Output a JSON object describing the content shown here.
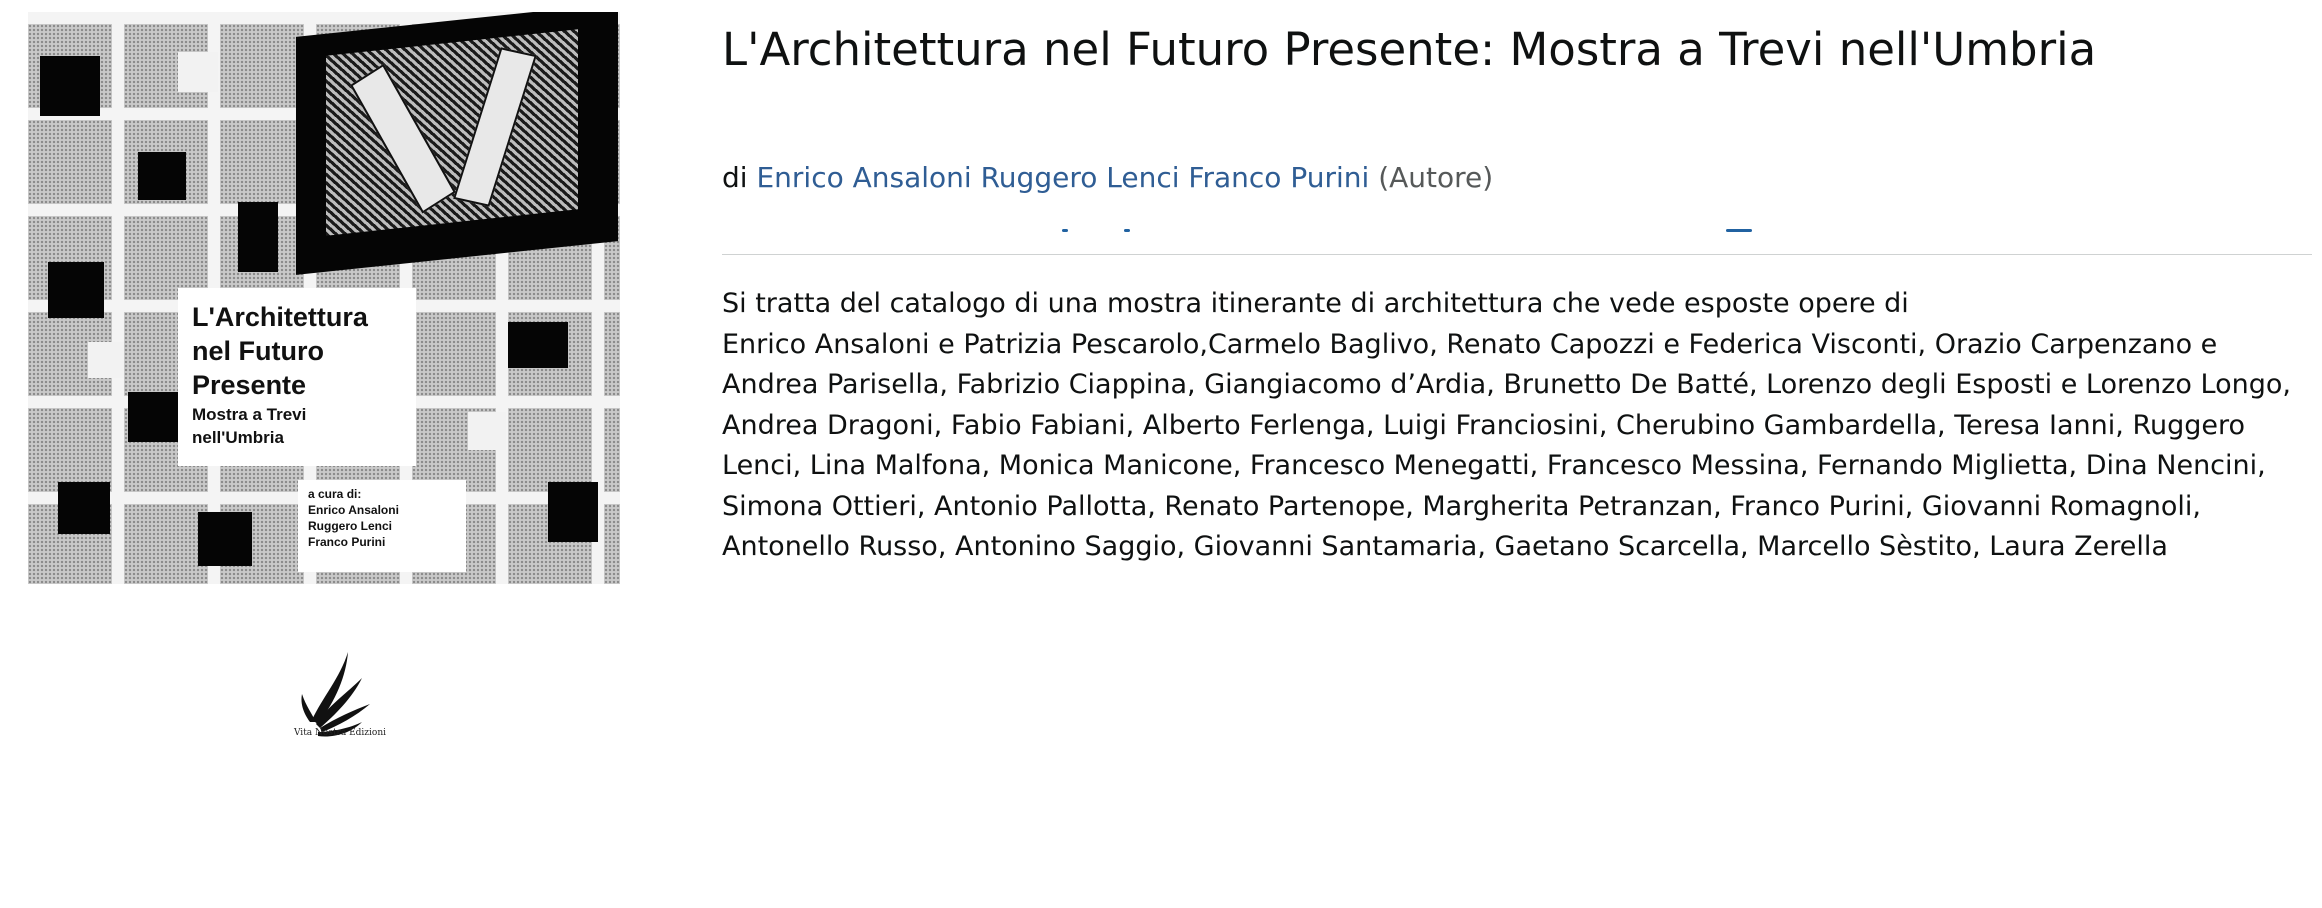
{
  "product": {
    "title": "L'Architettura nel Futuro Presente: Mostra a Trevi nell'Umbria",
    "byline_prefix": "di",
    "authors": "Enrico Ansaloni Ruggero Lenci Franco Purini",
    "role": "(Autore)",
    "description_line1": "Si tratta del catalogo di una mostra itinerante di architettura che vede esposte opere di",
    "description_line2": "Enrico Ansaloni e Patrizia Pescarolo,Carmelo Baglivo, Renato Capozzi e Federica Visconti, Orazio Carpenzano e Andrea Parisella, Fabrizio Ciappina, Giangiacomo d’Ardia, Brunetto De Batté, Lorenzo degli Esposti e Lorenzo Longo, Andrea Dragoni, Fabio Fabiani, Alberto Ferlenga, Luigi Franciosini, Cherubino Gambardella, Teresa Ianni, Ruggero Lenci, Lina Malfona, Monica Manicone, Francesco Menegatti, Francesco Messina, Fernando Miglietta, Dina Nencini, Simona Ottieri, Antonio Pallotta, Renato Partenope, Margherita Petranzan, Franco Purini, Giovanni Romagnoli, Antonello Russo, Antonino Saggio, Giovanni Santamaria, Gaetano Scarcella, Marcello Sèstito, Laura Zerella"
  },
  "cover": {
    "title_line1": "L'Architettura",
    "title_line2": "nel Futuro",
    "title_line3": "Presente",
    "subtitle_line1": "Mostra a Trevi",
    "subtitle_line2": "nell'Umbria",
    "curators_label": "a cura di:",
    "curator1": "Enrico Ansaloni",
    "curator2": "Ruggero Lenci",
    "curator3": "Franco Purini"
  },
  "publisher_logo": {
    "icon": "wing-logo-icon",
    "caption": "Vita Nostra Edizioni"
  },
  "colors": {
    "link": "#2f5d94",
    "text": "#0f1111",
    "muted": "#565959"
  }
}
